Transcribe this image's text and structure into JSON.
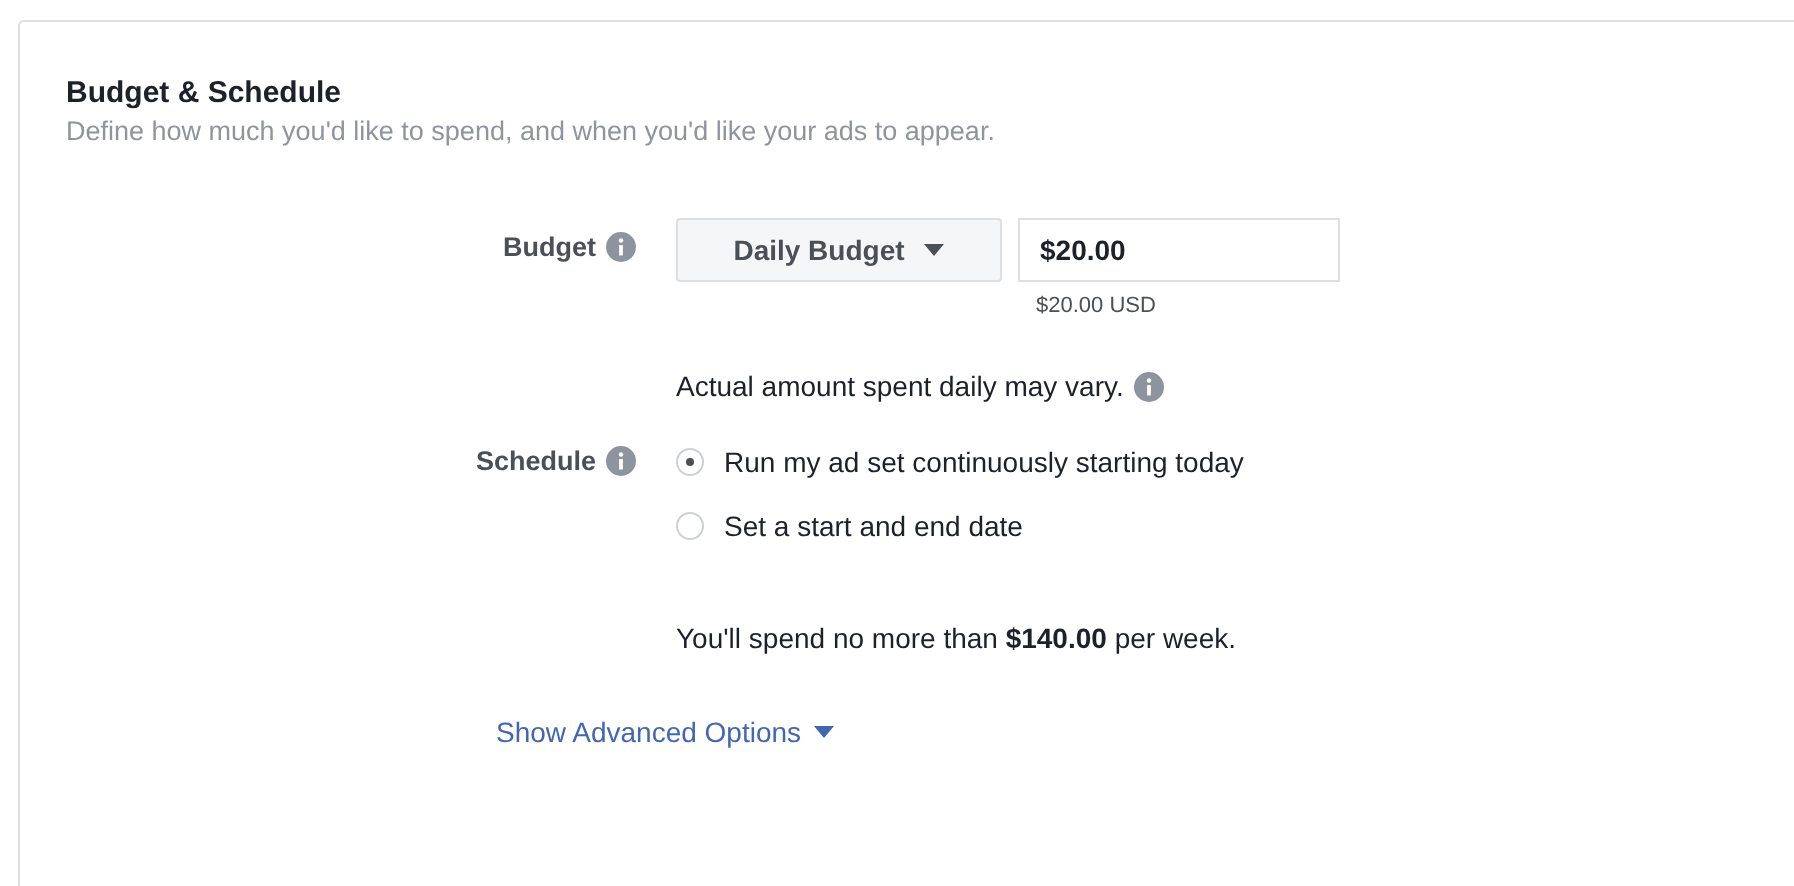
{
  "section": {
    "title": "Budget & Schedule",
    "subtitle": "Define how much you'd like to spend, and when you'd like your ads to appear."
  },
  "budget": {
    "label": "Budget",
    "type": "Daily Budget",
    "amount": "$20.00",
    "converted": "$20.00 USD",
    "note": "Actual amount spent daily may vary."
  },
  "schedule": {
    "label": "Schedule",
    "options": [
      {
        "label": "Run my ad set continuously starting today",
        "selected": true
      },
      {
        "label": "Set a start and end date",
        "selected": false
      }
    ]
  },
  "summary": "You'll spend no more than **$140.00** per week.",
  "advanced_link": "Show Advanced Options"
}
